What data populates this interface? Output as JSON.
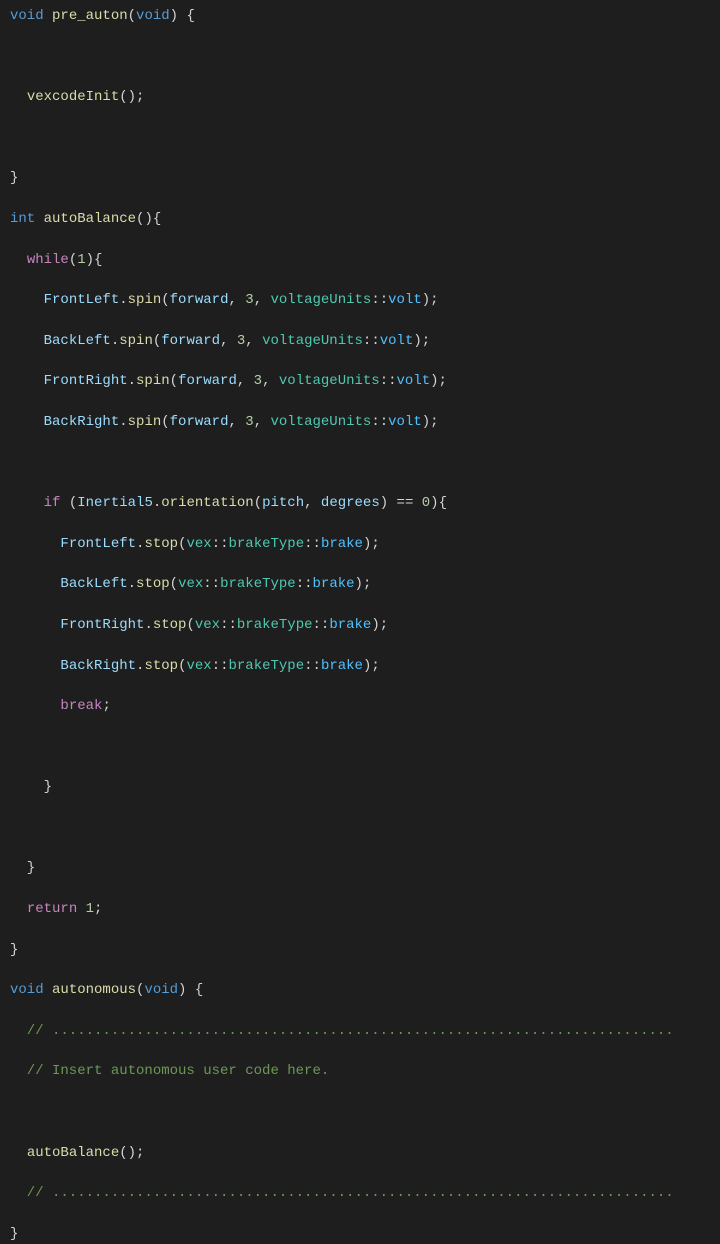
{
  "code": {
    "l1_void": "void",
    "l1_fn": "pre_auton",
    "l1_paramtype": "void",
    "l1_rest": ") {",
    "l3_call": "vexcodeInit",
    "l3_rest": "();",
    "l5_brace": "}",
    "l6_int": "int",
    "l6_fn": "autoBalance",
    "l6_rest": "(){",
    "l7_while": "while",
    "l7_one": "1",
    "l7_rest": "){",
    "l8_obj": "FrontLeft",
    "l8_fn": "spin",
    "l8_arg1": "forward",
    "l8_arg2": "3",
    "l8_arg3a": "voltageUnits",
    "l8_arg3b": "volt",
    "l9_obj": "BackLeft",
    "l9_fn": "spin",
    "l9_arg1": "forward",
    "l9_arg2": "3",
    "l9_arg3a": "voltageUnits",
    "l9_arg3b": "volt",
    "l10_obj": "FrontRight",
    "l10_fn": "spin",
    "l10_arg1": "forward",
    "l10_arg2": "3",
    "l10_arg3a": "voltageUnits",
    "l10_arg3b": "volt",
    "l11_obj": "BackRight",
    "l11_fn": "spin",
    "l11_arg1": "forward",
    "l11_arg2": "3",
    "l11_arg3a": "voltageUnits",
    "l11_arg3b": "volt",
    "l13_if": "if",
    "l13_obj": "Inertial5",
    "l13_fn": "orientation",
    "l13_arg1": "pitch",
    "l13_arg2": "degrees",
    "l13_eq": "==",
    "l13_zero": "0",
    "l14_obj": "FrontLeft",
    "l14_fn": "stop",
    "l14_ns": "vex",
    "l14_cls": "brakeType",
    "l14_val": "brake",
    "l15_obj": "BackLeft",
    "l15_fn": "stop",
    "l15_ns": "vex",
    "l15_cls": "brakeType",
    "l15_val": "brake",
    "l16_obj": "FrontRight",
    "l16_fn": "stop",
    "l16_ns": "vex",
    "l16_cls": "brakeType",
    "l16_val": "brake",
    "l17_obj": "BackRight",
    "l17_fn": "stop",
    "l17_ns": "vex",
    "l17_cls": "brakeType",
    "l17_val": "brake",
    "l18_break": "break",
    "l20_brace": "    }",
    "l22_brace": "  }",
    "l23_return": "return",
    "l23_one": "1",
    "l24_brace": "}",
    "l25_void": "void",
    "l25_fn": "autonomous",
    "l25_paramtype": "void",
    "l25_rest": ") {",
    "l26_comment": "  // ..........................................................................",
    "l27_comment": "  // Insert autonomous user code here.",
    "l29_call": "autoBalance",
    "l29_rest": "();",
    "l30_comment": "  // ..........................................................................",
    "l31_brace": "}"
  }
}
